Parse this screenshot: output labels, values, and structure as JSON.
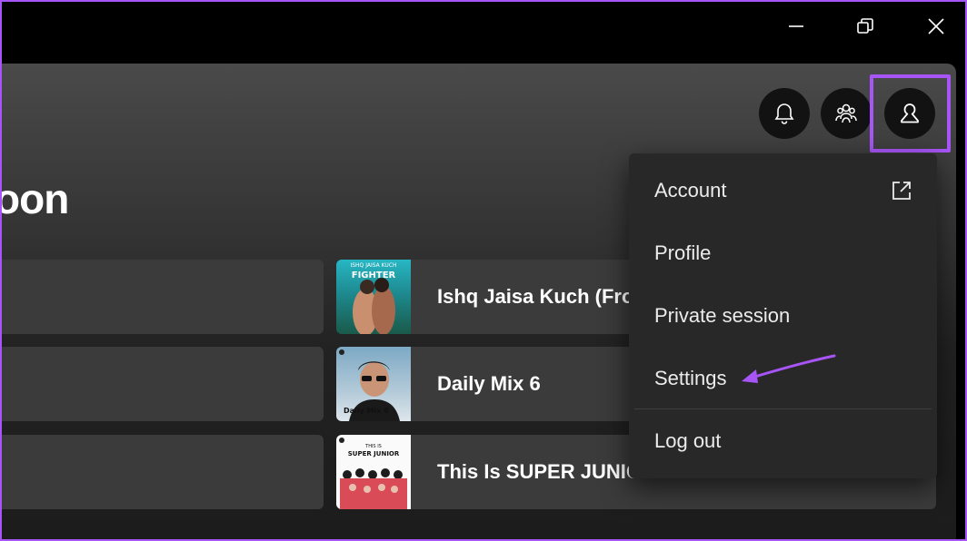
{
  "window": {
    "minimize_icon": "minimize-icon",
    "maximize_icon": "restore-icon",
    "close_icon": "close-icon"
  },
  "header": {
    "bell_icon": "bell-icon",
    "friends_icon": "friends-icon",
    "profile_icon": "user-icon",
    "highlight_color": "#a855f7"
  },
  "greeting": "oon",
  "shortcuts": [
    {
      "title": "Ishq Jaisa Kuch (Fro",
      "cover_top_text": "ISHQ JAISA KUCH",
      "cover_main_text": "FIGHTER"
    },
    {
      "title": "Daily Mix 6",
      "cover_caption": "Daily Mix 6"
    },
    {
      "title": "This Is SUPER JUNIOR",
      "cover_top_text": "THIS IS",
      "cover_main_text": "SUPER JUNIOR"
    }
  ],
  "menu": {
    "items": [
      {
        "label": "Account"
      },
      {
        "label": "Profile"
      },
      {
        "label": "Private session"
      },
      {
        "label": "Settings"
      },
      {
        "label": "Log out"
      }
    ],
    "external_icon": "external-link-icon"
  },
  "annotation": {
    "arrow_color": "#a855f7"
  }
}
